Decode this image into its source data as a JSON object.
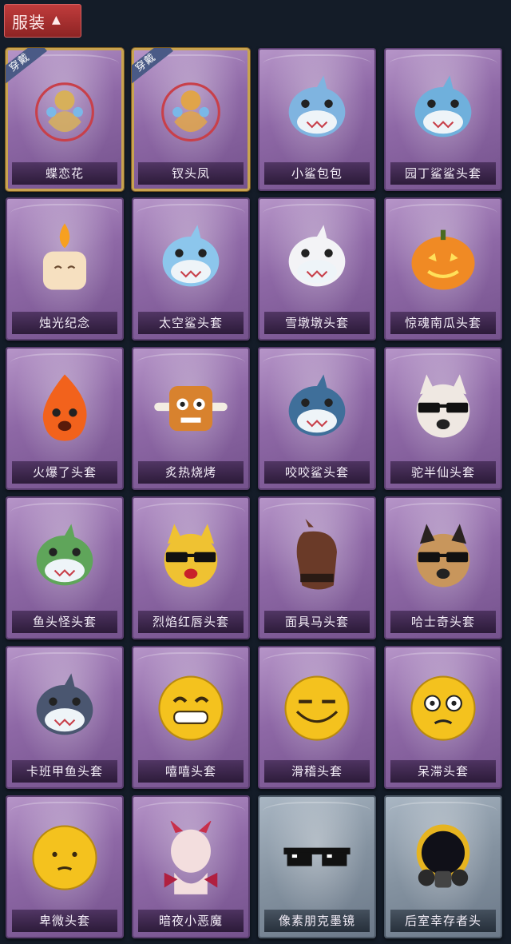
{
  "header": {
    "category_label": "服装"
  },
  "items": [
    {
      "name": "蝶恋花",
      "icon": "butterfly-flower-icon",
      "frame": "gold",
      "badge": "穿戴",
      "color": "#d7b05a"
    },
    {
      "name": "钗头凤",
      "icon": "phoenix-hairpin-icon",
      "frame": "gold",
      "badge": "穿戴",
      "color": "#e0a44a"
    },
    {
      "name": "小鲨包包",
      "icon": "shark-bag-icon",
      "frame": "purple",
      "badge": "",
      "color": "#7fb4e0"
    },
    {
      "name": "园丁鲨鲨头套",
      "icon": "gardener-shark-icon",
      "frame": "purple",
      "badge": "",
      "color": "#6fb0dc"
    },
    {
      "name": "烛光纪念",
      "icon": "candle-icon",
      "frame": "purple",
      "badge": "",
      "color": "#f6e0c0"
    },
    {
      "name": "太空鲨头套",
      "icon": "space-shark-icon",
      "frame": "purple",
      "badge": "",
      "color": "#8cc6ec"
    },
    {
      "name": "雪墩墩头套",
      "icon": "snowman-icon",
      "frame": "purple",
      "badge": "",
      "color": "#f3f3f6"
    },
    {
      "name": "惊魂南瓜头套",
      "icon": "pumpkin-icon",
      "frame": "purple",
      "badge": "",
      "color": "#f08a24"
    },
    {
      "name": "火爆了头套",
      "icon": "fireball-icon",
      "frame": "purple",
      "badge": "",
      "color": "#f2621c"
    },
    {
      "name": "炙热烧烤",
      "icon": "bbq-meat-icon",
      "frame": "purple",
      "badge": "",
      "color": "#d8822e"
    },
    {
      "name": "咬咬鲨头套",
      "icon": "biting-shark-icon",
      "frame": "purple",
      "badge": "",
      "color": "#3f6f9a"
    },
    {
      "name": "驼半仙头套",
      "icon": "bear-sunglasses-icon",
      "frame": "purple",
      "badge": "",
      "color": "#efe8e2"
    },
    {
      "name": "鱼头怪头套",
      "icon": "fish-head-icon",
      "frame": "purple",
      "badge": "",
      "color": "#5fa55a"
    },
    {
      "name": "烈焰红唇头套",
      "icon": "yellow-mask-icon",
      "frame": "purple",
      "badge": "",
      "color": "#efc232"
    },
    {
      "name": "面具马头套",
      "icon": "horse-mask-icon",
      "frame": "purple",
      "badge": "",
      "color": "#6a3a28"
    },
    {
      "name": "哈士奇头套",
      "icon": "husky-icon",
      "frame": "purple",
      "badge": "",
      "color": "#c8965c"
    },
    {
      "name": "卡班甲鱼头套",
      "icon": "fish-hat-icon",
      "frame": "purple",
      "badge": "",
      "color": "#4a5670"
    },
    {
      "name": "嘻嘻头套",
      "icon": "grin-emoji-icon",
      "frame": "purple",
      "badge": "",
      "color": "#f4c21e"
    },
    {
      "name": "滑稽头套",
      "icon": "funny-emoji-icon",
      "frame": "purple",
      "badge": "",
      "color": "#f4c21e"
    },
    {
      "name": "呆滞头套",
      "icon": "stunned-emoji-icon",
      "frame": "purple",
      "badge": "",
      "color": "#f4c21e"
    },
    {
      "name": "卑微头套",
      "icon": "humble-emoji-icon",
      "frame": "purple",
      "badge": "",
      "color": "#f4c21e"
    },
    {
      "name": "暗夜小恶魔",
      "icon": "little-devil-icon",
      "frame": "purple",
      "badge": "",
      "color": "#f3dede"
    },
    {
      "name": "像素朋克墨镜",
      "icon": "pixel-sunglasses-icon",
      "frame": "grey",
      "badge": "",
      "color": "#111111"
    },
    {
      "name": "后室幸存者头",
      "icon": "gas-mask-icon",
      "frame": "grey",
      "badge": "",
      "color": "#2a2a2a"
    }
  ]
}
